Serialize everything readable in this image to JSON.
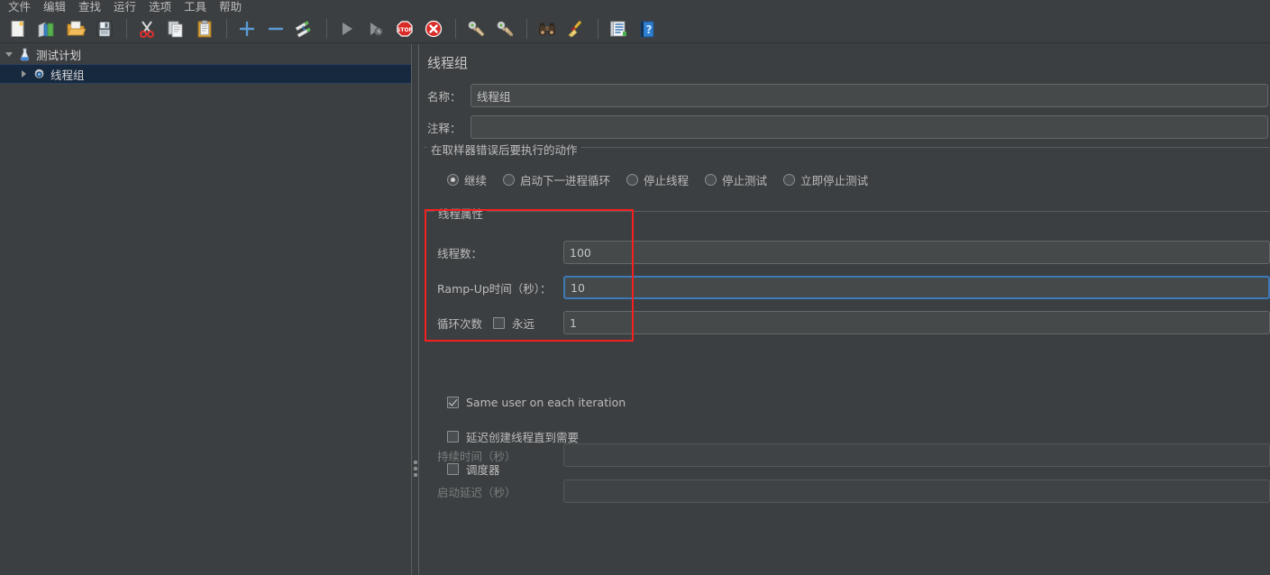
{
  "window": {
    "app": "Apache JMeter",
    "bg_color": "#3c3f41",
    "accent_color": "#3d7ab8",
    "annotation_color": "#f41f1f"
  },
  "menubar": {
    "items": [
      {
        "label": "文件",
        "name": "menu-file"
      },
      {
        "label": "编辑",
        "name": "menu-edit"
      },
      {
        "label": "查找",
        "name": "menu-search"
      },
      {
        "label": "运行",
        "name": "menu-run"
      },
      {
        "label": "选项",
        "name": "menu-options"
      },
      {
        "label": "工具",
        "name": "menu-tools"
      },
      {
        "label": "帮助",
        "name": "menu-help"
      }
    ]
  },
  "toolbar": {
    "buttons": [
      {
        "name": "new-icon",
        "title": "新建"
      },
      {
        "name": "templates-icon",
        "title": "模板"
      },
      {
        "name": "open-icon",
        "title": "打开"
      },
      {
        "name": "save-icon",
        "title": "保存"
      },
      {
        "name": "cut-icon",
        "title": "剪切"
      },
      {
        "name": "copy-icon",
        "title": "复制"
      },
      {
        "name": "paste-icon",
        "title": "粘贴"
      },
      {
        "name": "expand-icon",
        "title": "展开"
      },
      {
        "name": "collapse-icon",
        "title": "收起"
      },
      {
        "name": "toggle-icon",
        "title": "切换"
      },
      {
        "name": "start-icon",
        "title": "启动"
      },
      {
        "name": "start-no-pauses-icon",
        "title": "无间隔启动"
      },
      {
        "name": "stop-icon",
        "title": "停止"
      },
      {
        "name": "shutdown-icon",
        "title": "关闭"
      },
      {
        "name": "clear-icon",
        "title": "清除"
      },
      {
        "name": "clear-all-icon",
        "title": "清除全部"
      },
      {
        "name": "search-icon",
        "title": "搜索"
      },
      {
        "name": "reset-search-icon",
        "title": "重置搜索"
      },
      {
        "name": "function-helper-icon",
        "title": "函数助手对话框"
      },
      {
        "name": "help-icon",
        "title": "帮助"
      }
    ]
  },
  "tree": {
    "nodes": [
      {
        "label": "测试计划",
        "name": "tree-node-test-plan",
        "expanded": true,
        "selected": false,
        "icon": "test-plan-icon"
      },
      {
        "label": "线程组",
        "name": "tree-node-thread-group",
        "expanded": false,
        "selected": true,
        "icon": "thread-group-icon"
      }
    ]
  },
  "panel": {
    "title": "线程组",
    "name_label": "名称：",
    "name_value": "线程组",
    "comment_label": "注释：",
    "comment_value": "",
    "on_error": {
      "group_title": "在取样器错误后要执行的动作",
      "options": [
        {
          "label": "继续",
          "selected": true,
          "name": "radio-continue"
        },
        {
          "label": "启动下一进程循环",
          "selected": false,
          "name": "radio-start-next-loop"
        },
        {
          "label": "停止线程",
          "selected": false,
          "name": "radio-stop-thread"
        },
        {
          "label": "停止测试",
          "selected": false,
          "name": "radio-stop-test"
        },
        {
          "label": "立即停止测试",
          "selected": false,
          "name": "radio-stop-test-now"
        }
      ]
    },
    "thread_props": {
      "group_title": "线程属性",
      "threads_label": "线程数：",
      "threads_value": "100",
      "rampup_label": "Ramp-Up时间（秒）：",
      "rampup_value": "10",
      "rampup_focused": true,
      "loop_label": "循环次数",
      "forever_label": "永远",
      "forever_checked": false,
      "loop_value": "1"
    },
    "options": [
      {
        "label": "Same user on each iteration",
        "checked": true,
        "disabled": false,
        "name": "checkbox-same-user"
      },
      {
        "label": "延迟创建线程直到需要",
        "checked": false,
        "disabled": false,
        "name": "checkbox-delay-thread-creation"
      },
      {
        "label": "调度器",
        "checked": false,
        "disabled": false,
        "name": "checkbox-scheduler"
      }
    ],
    "scheduler": {
      "duration_label": "持续时间（秒）",
      "duration_value": "",
      "delay_label": "启动延迟（秒）",
      "delay_value": "",
      "disabled": true
    }
  }
}
